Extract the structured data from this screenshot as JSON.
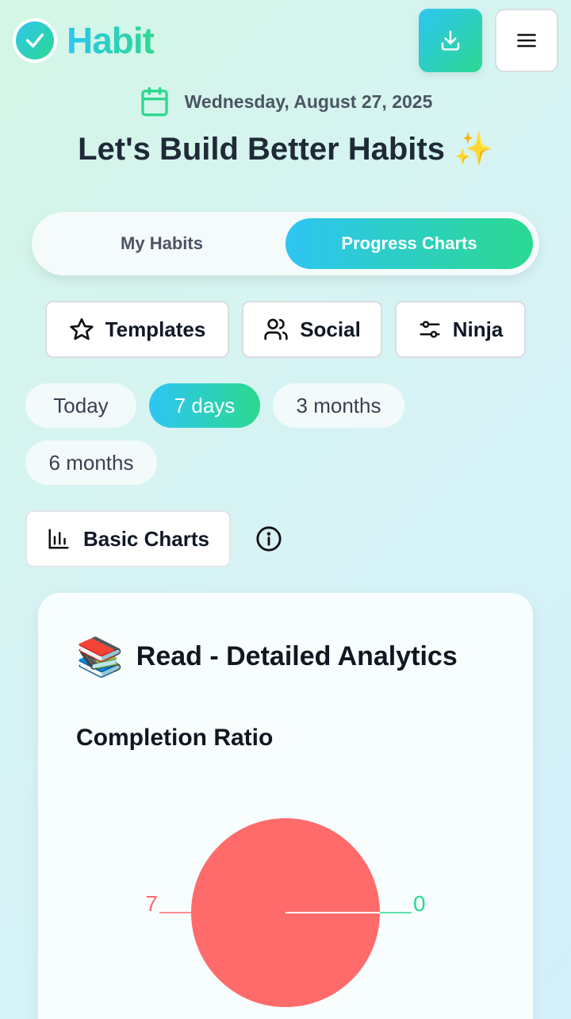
{
  "app": {
    "brand": "Habit"
  },
  "header": {
    "date": "Wednesday, August 27, 2025",
    "headline": "Let's Build Better Habits ✨"
  },
  "tabs": [
    {
      "label": "My Habits"
    },
    {
      "label": "Progress Charts",
      "active": true
    }
  ],
  "toolbar": [
    {
      "label": "Templates"
    },
    {
      "label": "Social"
    },
    {
      "label": "Ninja"
    }
  ],
  "ranges": [
    {
      "label": "Today"
    },
    {
      "label": "7 days",
      "active": true
    },
    {
      "label": "3 months"
    },
    {
      "label": "6 months"
    }
  ],
  "basic_charts": {
    "label": "Basic Charts"
  },
  "card": {
    "emoji": "📚",
    "title": "Read - Detailed Analytics",
    "section": "Completion Ratio"
  },
  "colors": {
    "accent_start": "#2ec5f4",
    "accent_end": "#2bd98f",
    "missed": "#ff6b6b",
    "completed": "#2bd98f"
  },
  "chart_data": {
    "type": "pie",
    "slices": [
      {
        "label": "7",
        "value": 7,
        "color": "#ff6b6b"
      },
      {
        "label": "0",
        "value": 0,
        "color": "#2bd98f"
      }
    ]
  }
}
